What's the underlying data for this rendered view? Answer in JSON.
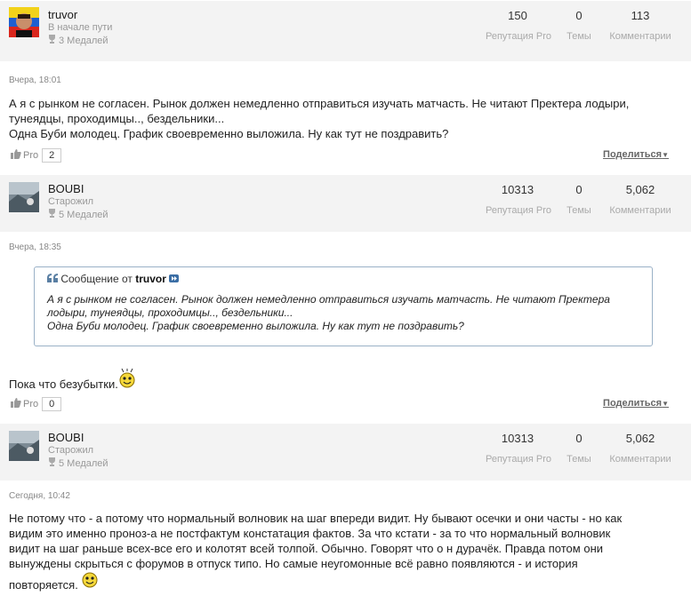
{
  "posts": [
    {
      "author": {
        "name": "truvor",
        "rank": "В начале пути",
        "medals": "3 Медалей"
      },
      "stats": {
        "reputation": "150",
        "topics": "0",
        "comments": "113"
      },
      "timestamp": "Вчера, 18:01",
      "body_lines": [
        "А я с рынком не согласен. Рынок должен немедленно отправиться изучать матчасть. Не читают Пректера лодыри,",
        "тунеядцы, проходимцы.., бездельники...",
        "Одна Буби молодец. График своевременно выложила. Ну как тут не поздравить?"
      ],
      "likes": {
        "label": "Pro",
        "count": "2"
      },
      "share_label": "Поделиться"
    },
    {
      "author": {
        "name": "BOUBI",
        "rank": "Старожил",
        "medals": "5 Медалей"
      },
      "stats": {
        "reputation": "10313",
        "topics": "0",
        "comments": "5,062"
      },
      "timestamp": "Вчера, 18:35",
      "quote": {
        "prefix": "Сообщение от",
        "author": "truvor",
        "lines": [
          "А я с рынком не согласен. Рынок должен немедленно отправиться изучать матчасть. Не читают Пректера",
          "лодыри, тунеядцы, проходимцы.., бездельники...",
          "Одна Буби молодец. График своевременно выложила. Ну как тут не поздравить?"
        ]
      },
      "body": "Пока что безубытки.",
      "likes": {
        "label": "Pro",
        "count": "0"
      },
      "share_label": "Поделиться"
    },
    {
      "author": {
        "name": "BOUBI",
        "rank": "Старожил",
        "medals": "5 Медалей"
      },
      "stats": {
        "reputation": "10313",
        "topics": "0",
        "comments": "5,062"
      },
      "timestamp": "Сегодня, 10:42",
      "body_lines": [
        "Не потому что - а потому что нормальный волновик на шаг впереди видит. Ну бывают осечки и они часты - но как",
        "видим это именно проноз-а не постфактум констатация фактов. За что кстати - за то что нормальный волновик",
        "видит на шаг раньше всех-все его и колотят всей толпой. Обычно. Говорят что о н дурачёк. Правда потом они",
        "вынуждены скрыться с форумов в отпуск типо. Но самые неугомонные всё равно появляются - и история",
        "повторяется."
      ]
    }
  ],
  "labels": {
    "reputation": "Репутация Pro",
    "topics": "Темы",
    "comments": "Комментарии"
  },
  "colors": {
    "author_bar": "#f3f3f3",
    "quote_border": "#9ab1c7",
    "smiley": "#f5d83a"
  }
}
